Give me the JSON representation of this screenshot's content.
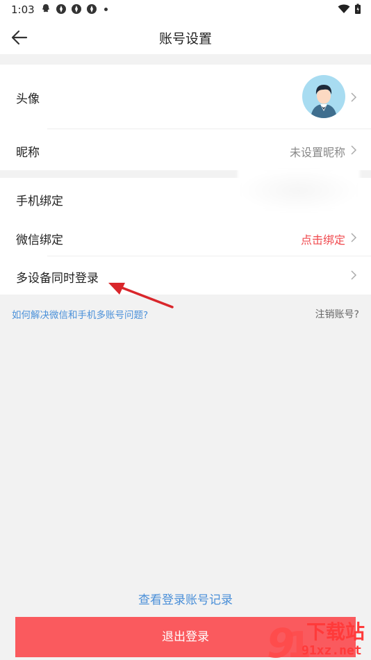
{
  "statusbar": {
    "time": "1:03"
  },
  "navbar": {
    "title": "账号设置"
  },
  "profile": {
    "avatar_label": "头像",
    "nickname_label": "昵称",
    "nickname_value": "未设置昵称"
  },
  "bindings": {
    "phone_label": "手机绑定",
    "wechat_label": "微信绑定",
    "wechat_value": "点击绑定",
    "multi_device_label": "多设备同时登录"
  },
  "links": {
    "help": "如何解决微信和手机多账号问题?",
    "cancel_account": "注销账号?",
    "login_history": "查看登录账号记录"
  },
  "logout_label": "退出登录",
  "watermark": {
    "brand": "下载站",
    "url": "91xz.net"
  },
  "colors": {
    "accent_red": "#fa5a5e",
    "link_blue": "#4a90d9",
    "avatar_bg": "#a8dcf1"
  }
}
